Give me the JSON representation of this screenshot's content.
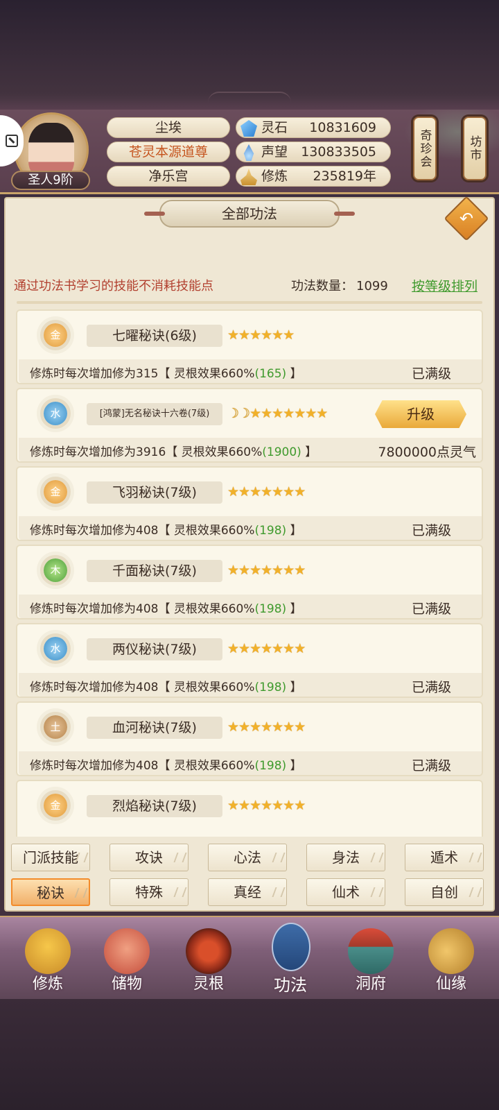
{
  "player": {
    "rank": "圣人9阶",
    "name": "尘埃",
    "title": "苍灵本源道尊",
    "sect": "净乐宫"
  },
  "stats": [
    {
      "label": "灵石",
      "value": "10831609",
      "icon": "spirit-stone-icon"
    },
    {
      "label": "声望",
      "value": "130833505",
      "icon": "reputation-icon"
    },
    {
      "label": "修炼",
      "value": "235819年",
      "icon": "cultivation-icon"
    }
  ],
  "side_buttons": {
    "treasure": "奇珍会",
    "market": "坊市"
  },
  "panel": {
    "title": "全部功法",
    "notice": "通过功法书学习的技能不消耗技能点",
    "count_label": "功法数量：",
    "count_value": "1099",
    "sort_link": "按等级排列"
  },
  "skills": [
    {
      "element": "金",
      "element_color": "#e09a3a",
      "name": "七曜秘诀(6级)",
      "stars": "★★★★★★",
      "desc_prefix": "修炼时每次增加修为315【 灵根效果660%",
      "desc_green": "(165)",
      "desc_suffix": " 】",
      "status": "已满级"
    },
    {
      "element": "水",
      "element_color": "#3b8fc8",
      "name": "[鸿蒙]无名秘诀十六卷(7级)",
      "moons": "☽☽",
      "stars": "★★★★★★★",
      "desc_prefix": "修炼时每次增加修为3916【 灵根效果660%",
      "desc_green": "(1900)",
      "desc_suffix": " 】",
      "status": "7800000点灵气",
      "button": "升级"
    },
    {
      "element": "金",
      "element_color": "#e09a3a",
      "name": "飞羽秘诀(7级)",
      "stars": "★★★★★★★",
      "desc_prefix": "修炼时每次增加修为408【 灵根效果660%",
      "desc_green": "(198)",
      "desc_suffix": " 】",
      "status": "已满级"
    },
    {
      "element": "木",
      "element_color": "#4ea03a",
      "name": "千面秘诀(7级)",
      "stars": "★★★★★★★",
      "desc_prefix": "修炼时每次增加修为408【 灵根效果660%",
      "desc_green": "(198)",
      "desc_suffix": " 】",
      "status": "已满级"
    },
    {
      "element": "水",
      "element_color": "#3b8fc8",
      "name": "两仪秘诀(7级)",
      "stars": "★★★★★★★",
      "desc_prefix": "修炼时每次增加修为408【 灵根效果660%",
      "desc_green": "(198)",
      "desc_suffix": " 】",
      "status": "已满级"
    },
    {
      "element": "土",
      "element_color": "#b5834a",
      "name": "血河秘诀(7级)",
      "stars": "★★★★★★★",
      "desc_prefix": "修炼时每次增加修为408【 灵根效果660%",
      "desc_green": "(198)",
      "desc_suffix": " 】",
      "status": "已满级"
    },
    {
      "element": "金",
      "element_color": "#e09a3a",
      "name": "烈焰秘诀(7级)",
      "stars": "★★★★★★★"
    }
  ],
  "categories": [
    {
      "label": "门派技能"
    },
    {
      "label": "攻诀"
    },
    {
      "label": "心法"
    },
    {
      "label": "身法"
    },
    {
      "label": "遁术"
    },
    {
      "label": "秘诀",
      "active": true
    },
    {
      "label": "特殊"
    },
    {
      "label": "真经"
    },
    {
      "label": "仙术"
    },
    {
      "label": "自创"
    }
  ],
  "nav": [
    {
      "label": "修炼",
      "icon": "cultivate-icon"
    },
    {
      "label": "储物",
      "icon": "storage-bag-icon"
    },
    {
      "label": "灵根",
      "icon": "spirit-root-icon"
    },
    {
      "label": "功法",
      "icon": "skill-book-icon",
      "active": true
    },
    {
      "label": "洞府",
      "icon": "cave-residence-icon"
    },
    {
      "label": "仙缘",
      "icon": "immortal-fate-icon"
    }
  ]
}
